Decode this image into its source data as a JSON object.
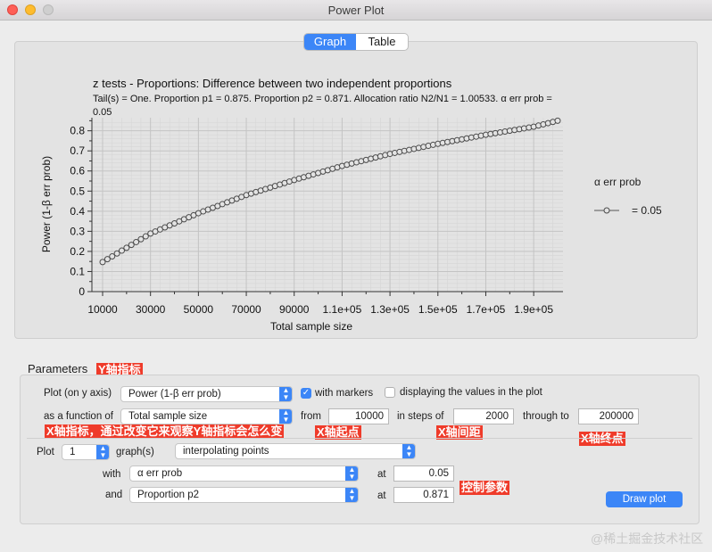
{
  "window": {
    "title": "Power Plot"
  },
  "tabs": [
    {
      "label": "Graph",
      "active": true
    },
    {
      "label": "Table",
      "active": false
    }
  ],
  "chart_data": {
    "type": "line",
    "title": "z tests - Proportions: Difference between two independent proportions",
    "subtitle": "Tail(s) = One. Proportion p1 = 0.875. Proportion p2 = 0.871. Allocation ratio N2/N1 = 1.00533. α err prob = 0.05",
    "xlabel": "Total sample size",
    "ylabel": "Power (1-β err prob)",
    "xlim": [
      10000,
      200000
    ],
    "ylim": [
      0,
      0.85
    ],
    "x_ticks": [
      "10000",
      "30000",
      "50000",
      "70000",
      "90000",
      "1.1e+05",
      "1.3e+05",
      "1.5e+05",
      "1.7e+05",
      "1.9e+05"
    ],
    "x_tick_values": [
      10000,
      30000,
      50000,
      70000,
      90000,
      110000,
      130000,
      150000,
      170000,
      190000
    ],
    "y_ticks": [
      "0",
      "0.1",
      "0.2",
      "0.3",
      "0.4",
      "0.5",
      "0.6",
      "0.7",
      "0.8"
    ],
    "y_tick_values": [
      0,
      0.1,
      0.2,
      0.3,
      0.4,
      0.5,
      0.6,
      0.7,
      0.8
    ],
    "legend": {
      "title": "α err prob",
      "entries": [
        {
          "label": "= 0.05"
        }
      ],
      "position": "right"
    },
    "series": [
      {
        "name": "= 0.05",
        "markers": true,
        "x": [
          10000,
          30000,
          50000,
          70000,
          90000,
          110000,
          130000,
          150000,
          170000,
          190000,
          200000
        ],
        "y": [
          0.147,
          0.289,
          0.39,
          0.48,
          0.555,
          0.625,
          0.685,
          0.735,
          0.78,
          0.82,
          0.85
        ]
      }
    ]
  },
  "parameters": {
    "label": "Parameters",
    "plot_y_label": "Plot (on y axis)",
    "plot_y_value": "Power (1-β err prob)",
    "with_markers_label": "with markers",
    "with_markers_checked": true,
    "display_values_label": "displaying the values in the plot",
    "display_values_checked": false,
    "as_function_label": "as a function of",
    "as_function_value": "Total sample size",
    "from_label": "from",
    "from_value": "10000",
    "steps_label": "in steps of",
    "steps_value": "2000",
    "through_label": "through to",
    "through_value": "200000",
    "plot_label": "Plot",
    "plot_count": "1",
    "graphs_label": "graph(s)",
    "graph_mode": "interpolating points",
    "with_label": "with",
    "with_value": "α err prob",
    "at_label": "at",
    "with_at_value": "0.05",
    "and_label": "and",
    "and_value": "Proportion p2",
    "and_at_value": "0.871",
    "draw_button": "Draw plot"
  },
  "annotations": {
    "y_metric": "Y轴指标",
    "x_metric": "X轴指标，通过改变它来观察Y轴指标会怎么变",
    "x_start": "X轴起点",
    "x_step": "X轴间距",
    "x_end": "X轴终点",
    "control": "控制参数"
  },
  "watermark": "@稀土掘金技术社区"
}
